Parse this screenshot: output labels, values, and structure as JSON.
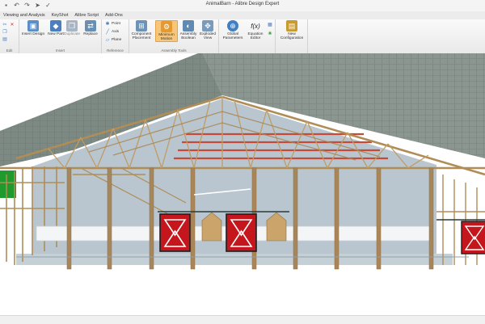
{
  "window": {
    "title": "AnimalBarn - Alibre Design Expert"
  },
  "quick_access": [
    {
      "name": "save-icon",
      "glyph": "■"
    },
    {
      "name": "undo-icon",
      "glyph": "↶"
    },
    {
      "name": "redo-icon",
      "glyph": "↷"
    },
    {
      "name": "arrow-icon",
      "glyph": "➤"
    },
    {
      "name": "check-icon",
      "glyph": "✓"
    }
  ],
  "menu": [
    "Viewing and Analysis",
    "KeyShot",
    "Alibre Script",
    "Add-Ons"
  ],
  "ribbon": {
    "edit": {
      "label": "Edit"
    },
    "insert": {
      "label": "Insert",
      "insert_design": "Insert Design",
      "new_part": "New Part",
      "duplicate": "Duplicate",
      "replace": "Replace"
    },
    "reference": {
      "label": "Reference",
      "point": "Point",
      "axis": "Axis",
      "plane": "Plane"
    },
    "assembly_tools": {
      "label": "Assembly Tools",
      "component_placement": "Component Placement",
      "minimum_motion": "Minimum Motion",
      "assembly_boolean": "Assembly Boolean",
      "exploded_view": "Exploded View"
    },
    "parameters": {
      "global_parameters": "Global Parameters",
      "equation_editor": "Equation Editor",
      "fx_glyph": "f(x)"
    },
    "configurations": {
      "new_configuration": "New Configuration"
    }
  },
  "colors": {
    "roof": "#7f8b84",
    "wood": "#b08d57",
    "wood_dark": "#8e6e3f",
    "wall": "#b9c6cf",
    "door_red": "#c4161c",
    "accent_active": "#f7c67a"
  }
}
